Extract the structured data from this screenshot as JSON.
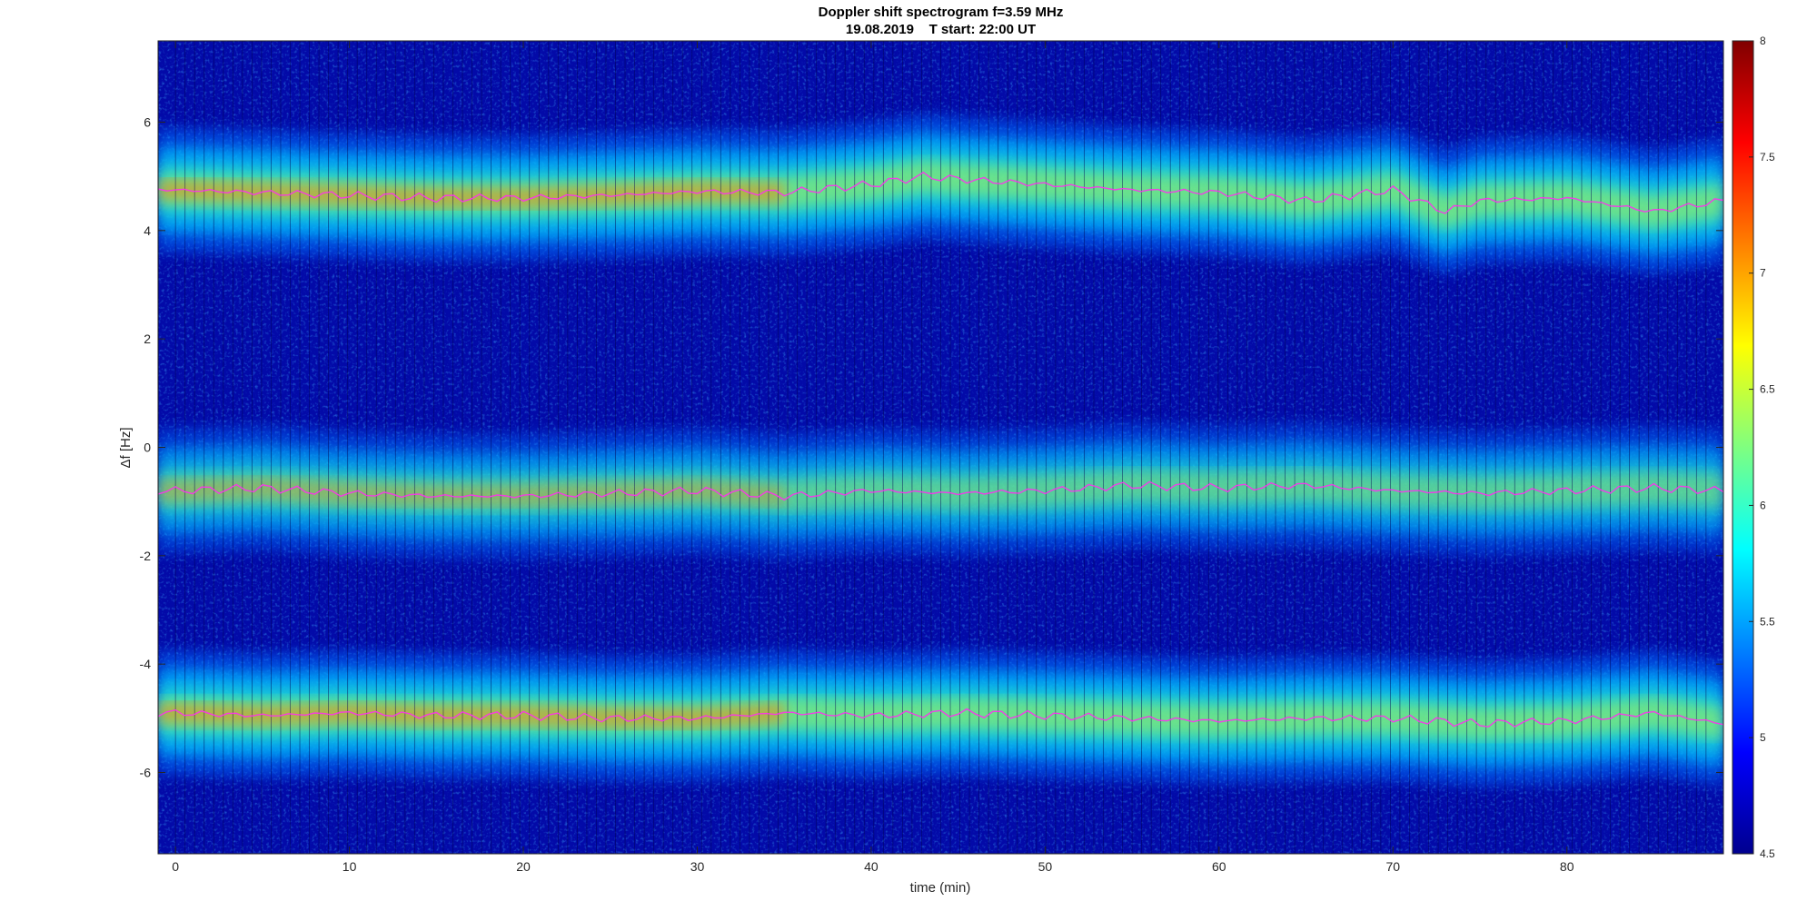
{
  "chart_data": {
    "type": "heatmap",
    "title": "Doppler shift spectrogram f=3.59 MHz",
    "subtitle": "19.08.2019    T start: 22:00 UT",
    "xlabel": "time (min)",
    "ylabel": "Δf [Hz]",
    "xlim": [
      -1,
      89
    ],
    "ylim": [
      -7.5,
      7.5
    ],
    "x_ticks": [
      0,
      10,
      20,
      30,
      40,
      50,
      60,
      70,
      80
    ],
    "y_ticks": [
      -6,
      -4,
      -2,
      0,
      2,
      4,
      6
    ],
    "colorbar": {
      "colormap": "jet",
      "clim": [
        4.5,
        8
      ],
      "ticks": [
        4.5,
        5,
        5.5,
        6,
        6.5,
        7,
        7.5,
        8
      ]
    },
    "series": [
      {
        "x": [
          0,
          5,
          10,
          15,
          20,
          25,
          30,
          35,
          40,
          43,
          45,
          50,
          55,
          60,
          65,
          70,
          73,
          75,
          80,
          85,
          89
        ],
        "y": [
          4.75,
          4.7,
          4.65,
          4.6,
          4.6,
          4.65,
          4.72,
          4.7,
          4.85,
          5.0,
          4.95,
          4.85,
          4.75,
          4.7,
          4.55,
          4.75,
          4.35,
          4.55,
          4.6,
          4.35,
          4.55
        ],
        "color": "#ff2df0"
      },
      {
        "x": [
          0,
          5,
          10,
          15,
          20,
          25,
          30,
          35,
          40,
          45,
          50,
          55,
          60,
          65,
          70,
          75,
          80,
          85,
          89
        ],
        "y": [
          -0.8,
          -0.75,
          -0.85,
          -0.9,
          -0.9,
          -0.85,
          -0.8,
          -0.9,
          -0.8,
          -0.85,
          -0.8,
          -0.7,
          -0.75,
          -0.7,
          -0.8,
          -0.85,
          -0.8,
          -0.75,
          -0.8
        ],
        "color": "#ff2df0"
      },
      {
        "x": [
          0,
          5,
          10,
          15,
          20,
          25,
          30,
          35,
          40,
          45,
          50,
          55,
          60,
          65,
          70,
          75,
          80,
          85,
          89
        ],
        "y": [
          -4.9,
          -4.95,
          -4.9,
          -4.95,
          -4.95,
          -5.0,
          -5.0,
          -4.9,
          -4.95,
          -4.9,
          -4.95,
          -5.0,
          -5.05,
          -5.0,
          -5.0,
          -5.1,
          -5.05,
          -4.9,
          -5.1
        ],
        "color": "#ff2df0"
      }
    ],
    "colors": {
      "background": "#00008f",
      "peak_trace": "#ff2df0"
    }
  }
}
